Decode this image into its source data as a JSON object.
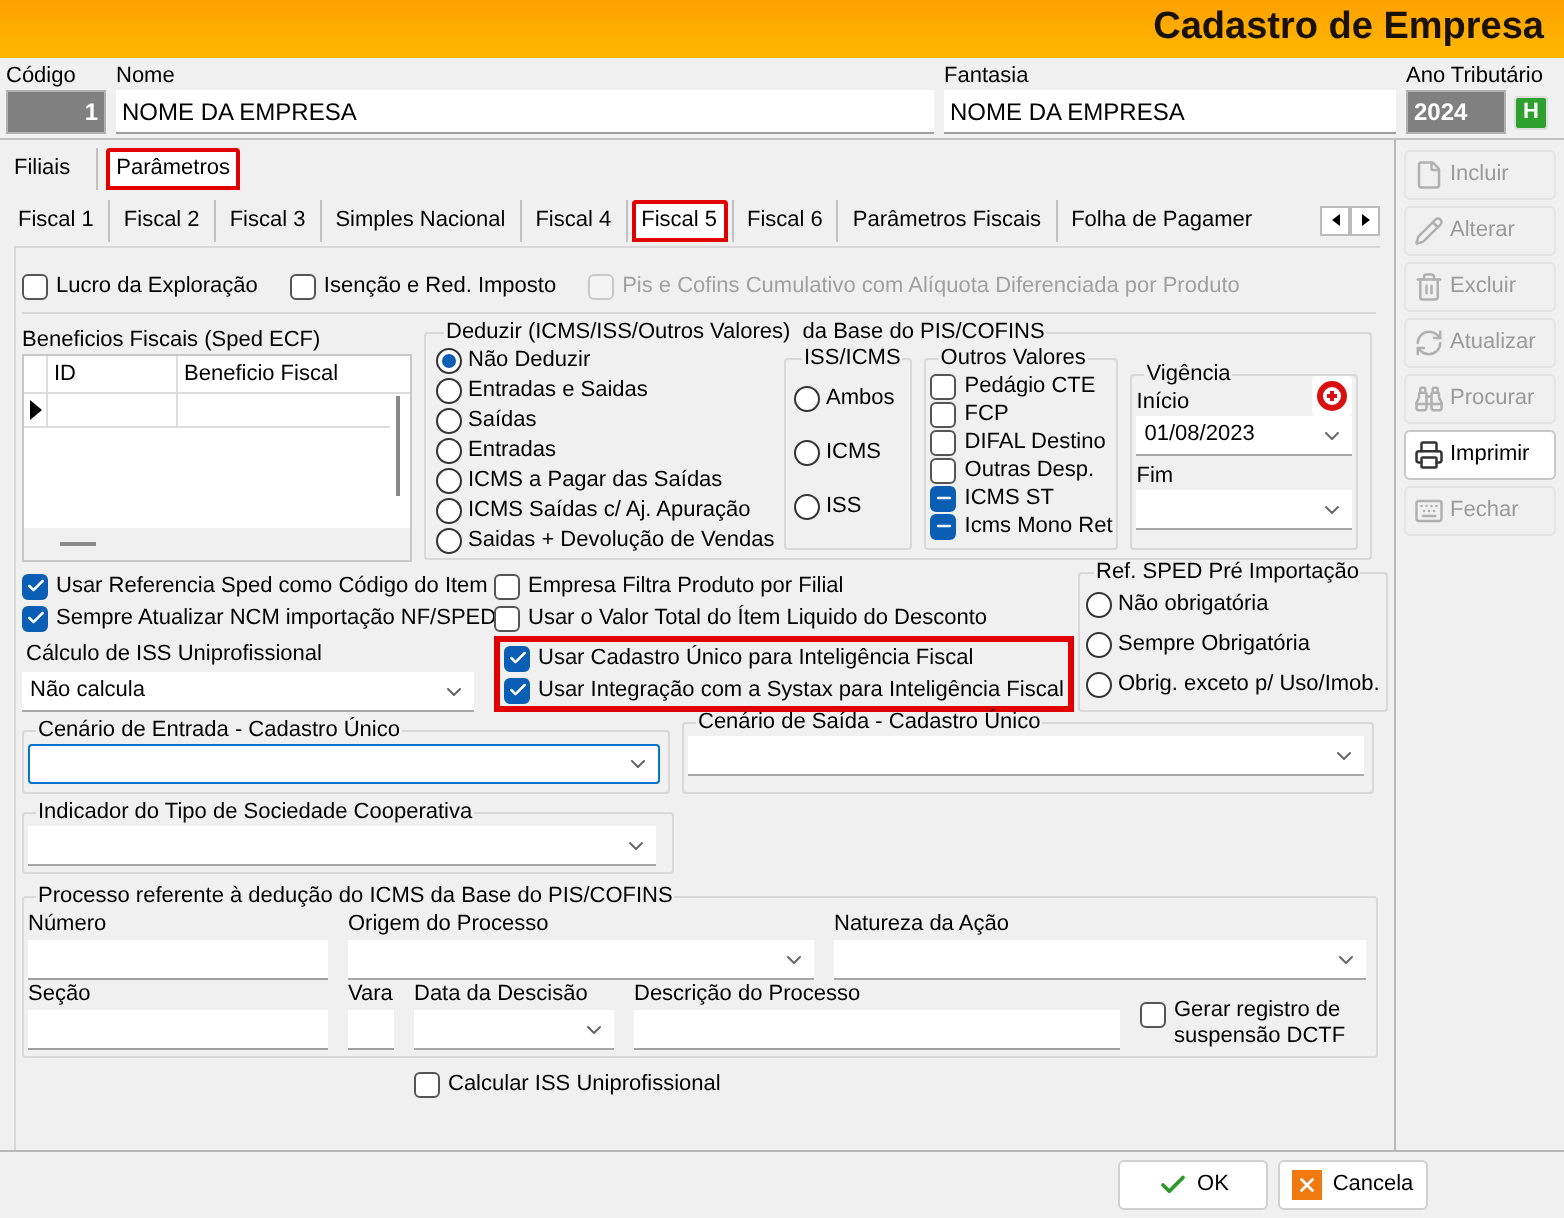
{
  "window": {
    "title": "Cadastro de Empresa"
  },
  "header": {
    "fields": [
      {
        "label": "Código",
        "value": "1",
        "kind": "code"
      },
      {
        "label": "Nome",
        "value": "NOME DA EMPRESA",
        "kind": "text"
      },
      {
        "label": "Fantasia",
        "value": "NOME DA EMPRESA",
        "kind": "text"
      },
      {
        "label": "Ano Tributário",
        "value": "2024",
        "kind": "year"
      }
    ],
    "year_button": "H"
  },
  "outer_tabs": [
    {
      "label": "Filiais",
      "selected": false,
      "highlighted": false
    },
    {
      "label": "Parâmetros",
      "selected": true,
      "highlighted": true
    }
  ],
  "inner_tabs": [
    {
      "label": "Fiscal 1",
      "selected": false,
      "highlighted": false
    },
    {
      "label": "Fiscal 2",
      "selected": false,
      "highlighted": false
    },
    {
      "label": "Fiscal 3",
      "selected": false,
      "highlighted": false
    },
    {
      "label": "Simples Nacional",
      "selected": false,
      "highlighted": false
    },
    {
      "label": "Fiscal 4",
      "selected": false,
      "highlighted": false
    },
    {
      "label": "Fiscal 5",
      "selected": true,
      "highlighted": true
    },
    {
      "label": "Fiscal 6",
      "selected": false,
      "highlighted": false
    },
    {
      "label": "Parâmetros Fiscais",
      "selected": false,
      "highlighted": false
    },
    {
      "label": "Folha de Pagamer",
      "selected": false,
      "highlighted": false
    }
  ],
  "top_checks": [
    {
      "label": "Lucro da Exploração",
      "checked": false,
      "disabled": false
    },
    {
      "label": "Isenção e Red. Imposto",
      "checked": false,
      "disabled": false
    },
    {
      "label": "Pis e Cofins Cumulativo com Alíquota Diferenciada por Produto",
      "checked": false,
      "disabled": true
    }
  ],
  "beneficios": {
    "title": "Beneficios Fiscais (Sped ECF)",
    "columns": [
      "ID",
      "Beneficio Fiscal"
    ]
  },
  "deduzir": {
    "title": "Deduzir (ICMS/ISS/Outros Valores)  da Base do PIS/COFINS",
    "options": [
      {
        "label": "Não Deduzir",
        "selected": true
      },
      {
        "label": "Entradas e Saidas",
        "selected": false
      },
      {
        "label": "Saídas",
        "selected": false
      },
      {
        "label": "Entradas",
        "selected": false
      },
      {
        "label": "ICMS a Pagar das Saídas",
        "selected": false
      },
      {
        "label": "ICMS Saídas c/ Aj. Apuração",
        "selected": false
      },
      {
        "label": "Saidas +  Devolução de Vendas",
        "selected": false
      }
    ]
  },
  "iss_icms": {
    "title": "ISS/ICMS",
    "options": [
      {
        "label": "Ambos",
        "selected": false
      },
      {
        "label": "ICMS",
        "selected": false
      },
      {
        "label": "ISS",
        "selected": false
      }
    ]
  },
  "outros_valores": {
    "title": "Outros Valores",
    "items": [
      {
        "label": "Pedágio CTE",
        "checked": false,
        "mixed": false
      },
      {
        "label": "FCP",
        "checked": false,
        "mixed": false
      },
      {
        "label": "DIFAL Destino",
        "checked": false,
        "mixed": false
      },
      {
        "label": "Outras Desp.",
        "checked": false,
        "mixed": false
      },
      {
        "label": "ICMS ST",
        "checked": true,
        "mixed": true
      },
      {
        "label": "Icms Mono Ret",
        "checked": true,
        "mixed": true
      }
    ]
  },
  "vigencia": {
    "title": "Vigência",
    "start_label": "Início",
    "start_value": "01/08/2023",
    "end_label": "Fim"
  },
  "left_checks": [
    {
      "label": "Usar Referencia Sped como Código do Item",
      "checked": true
    },
    {
      "label": "Sempre Atualizar NCM importação NF/SPED",
      "checked": true
    }
  ],
  "iss_calc": {
    "label": "Cálculo de ISS Uniprofissional",
    "value": "Não calcula"
  },
  "middle_checks": [
    {
      "label": "Empresa Filtra Produto por Filial",
      "checked": false
    },
    {
      "label": "Usar o Valor Total do Ítem Liquido do Desconto",
      "checked": false
    }
  ],
  "highlighted_checks": [
    {
      "label": "Usar Cadastro Único para Inteligência Fiscal",
      "checked": true
    },
    {
      "label": "Usar Integração com a Systax para Inteligência Fiscal",
      "checked": true
    }
  ],
  "ref_sped": {
    "title": "Ref. SPED Pré Importação",
    "options": [
      {
        "label": "Não obrigatória",
        "selected": false
      },
      {
        "label": "Sempre Obrigatória",
        "selected": false
      },
      {
        "label": "Obrig. exceto p/ Uso/Imob.",
        "selected": false
      }
    ]
  },
  "cenario_entrada": {
    "title": "Cenário de Entrada - Cadastro Único",
    "focused": true
  },
  "cenario_saida": {
    "title": "Cenário de Saída - Cadastro Único",
    "focused": false
  },
  "cooperativa": {
    "title": "Indicador do Tipo de Sociedade Cooperativa",
    "focused": false
  },
  "processo": {
    "title": "Processo referente à dedução do ICMS da Base do PIS/COFINS",
    "fields": [
      {
        "label": "Número",
        "kind": "text"
      },
      {
        "label": "Origem do Processo",
        "kind": "combo"
      },
      {
        "label": "Natureza da Ação",
        "kind": "combo"
      },
      {
        "label": "Seção",
        "kind": "text"
      },
      {
        "label": "Vara",
        "kind": "text"
      },
      {
        "label": "Data da Descisão",
        "kind": "combo"
      },
      {
        "label": "Descrição do Processo",
        "kind": "text"
      }
    ],
    "check": {
      "label": "Gerar registro de suspensão DCTF",
      "checked": false
    }
  },
  "bottom_check": {
    "label": "Calcular ISS Uniprofissional",
    "checked": false
  },
  "side_buttons": [
    {
      "label": "Incluir",
      "kind": "new",
      "disabled": true
    },
    {
      "label": "Alterar",
      "kind": "edit",
      "disabled": true
    },
    {
      "label": "Excluir",
      "kind": "delete",
      "disabled": true
    },
    {
      "label": "Atualizar",
      "kind": "refresh",
      "disabled": true
    },
    {
      "label": "Procurar",
      "kind": "search",
      "disabled": true
    },
    {
      "label": "Imprimir",
      "kind": "print",
      "disabled": false
    },
    {
      "label": "Fechar",
      "kind": "close",
      "disabled": true
    }
  ],
  "dialog_buttons": [
    {
      "label": "OK",
      "kind": "ok"
    },
    {
      "label": "Cancela",
      "kind": "cancel"
    }
  ]
}
